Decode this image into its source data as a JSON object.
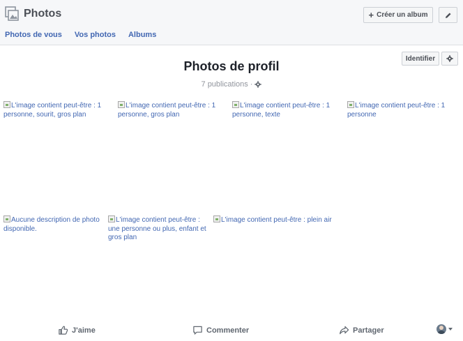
{
  "header": {
    "title": "Photos",
    "create_album_label": "Créer un album",
    "tabs": [
      {
        "label": "Photos de vous"
      },
      {
        "label": "Vos photos"
      },
      {
        "label": "Albums"
      }
    ]
  },
  "album": {
    "identify_label": "Identifier",
    "title": "Photos de profil",
    "publications": "7 publications",
    "separator": "·"
  },
  "photos": [
    {
      "alt": "L'image contient peut-être : 1 personne, sourit, gros plan"
    },
    {
      "alt": "L'image contient peut-être : 1 personne, gros plan"
    },
    {
      "alt": "L'image contient peut-être : 1 personne, texte"
    },
    {
      "alt": "L'image contient peut-être : 1 personne"
    },
    {
      "alt": "Aucune description de photo disponible."
    },
    {
      "alt": "L'image contient peut-être : une personne ou plus, enfant et gros plan"
    },
    {
      "alt": "L'image contient peut-être : plein air"
    }
  ],
  "actions": {
    "like": "J'aime",
    "comment": "Commenter",
    "share": "Partager"
  },
  "colors": {
    "link": "#4267b2",
    "header_bg": "#f6f7f9",
    "muted": "#90949c"
  },
  "icons": [
    "photos-icon",
    "plus-icon",
    "pencil-icon",
    "gear-icon",
    "thumbs-up-icon",
    "comment-icon",
    "share-icon",
    "avatar",
    "chevron-down-icon"
  ]
}
